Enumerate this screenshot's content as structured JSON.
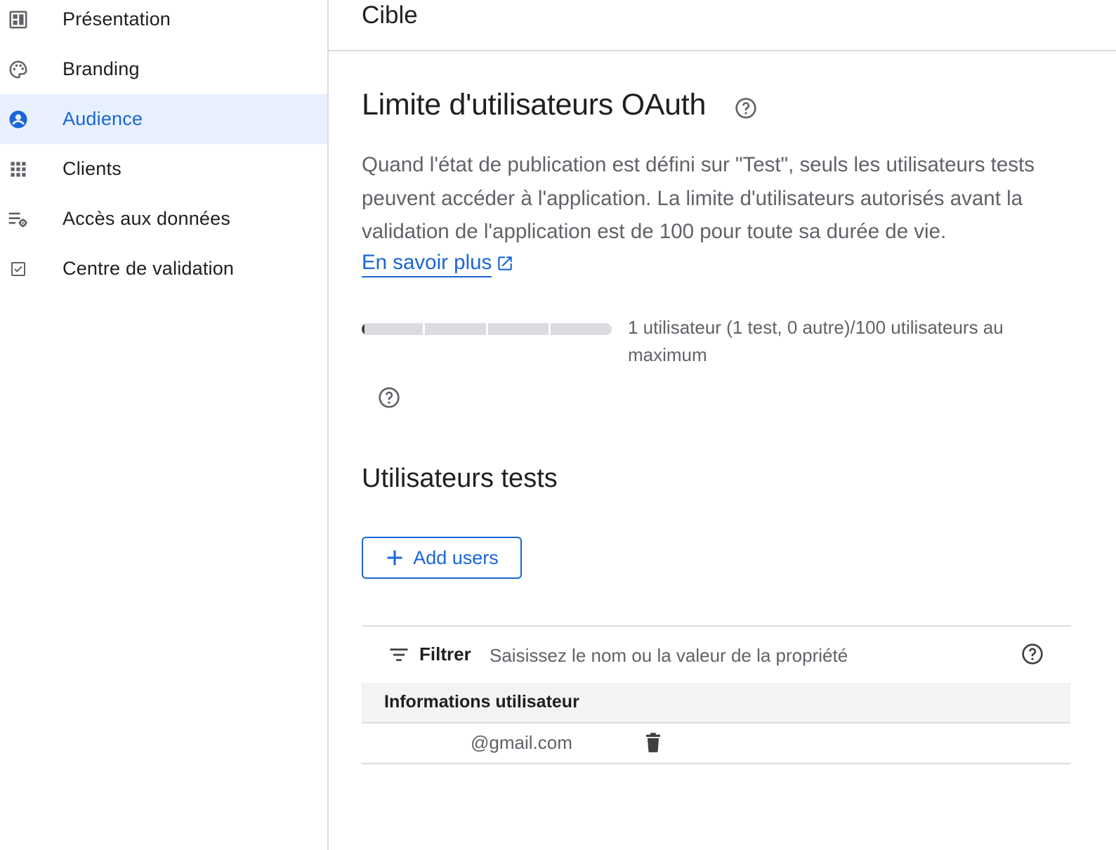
{
  "sidebar": {
    "items": [
      {
        "label": "Présentation",
        "icon": "dashboard-icon"
      },
      {
        "label": "Branding",
        "icon": "palette-icon"
      },
      {
        "label": "Audience",
        "icon": "person-icon",
        "active": true
      },
      {
        "label": "Clients",
        "icon": "apps-grid-icon"
      },
      {
        "label": "Accès aux données",
        "icon": "data-access-icon"
      },
      {
        "label": "Centre de validation",
        "icon": "checkbox-icon"
      }
    ]
  },
  "main": {
    "page_title": "Cible",
    "limit_section": {
      "title": "Limite d'utilisateurs OAuth",
      "description": "Quand l'état de publication est défini sur \"Test\", seuls les utilisateurs tests peuvent accéder à l'application. La limite d'utilisateurs autorisés avant la validation de l'application est de 100 pour toute sa durée de vie.",
      "learn_more": "En savoir plus",
      "usage_text": "1 utilisateur (1 test, 0 autre)/100 utilisateurs au maximum",
      "usage_fraction": 0.01
    },
    "test_users": {
      "title": "Utilisateurs tests",
      "add_button": "Add users",
      "filter_label": "Filtrer",
      "filter_placeholder": "Saisissez le nom ou la valeur de la propriété",
      "column_header": "Informations utilisateur",
      "rows": [
        {
          "email": "@gmail.com"
        }
      ]
    }
  },
  "colors": {
    "accent": "#1a66d6",
    "active_bg": "#e8f0fe",
    "muted_text": "#5f6368",
    "divider": "#dadce0"
  }
}
